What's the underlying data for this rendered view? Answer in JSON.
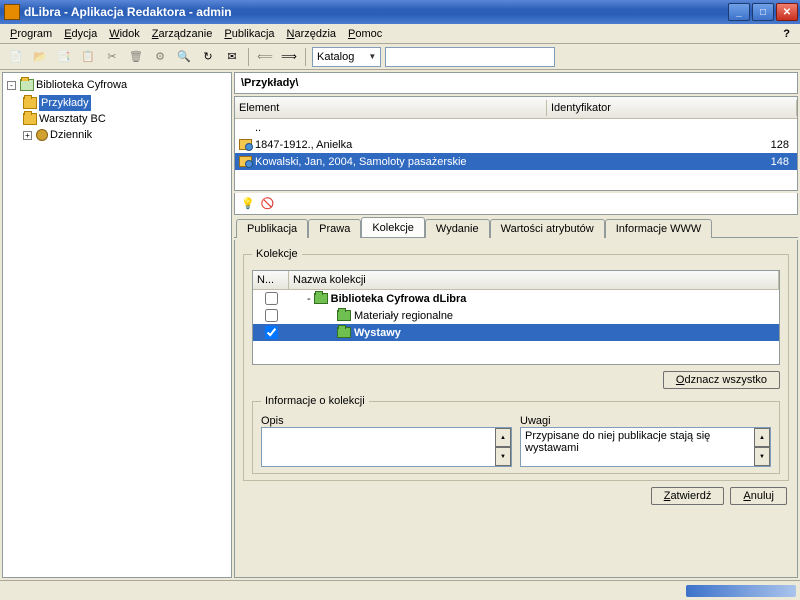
{
  "window": {
    "title": "dLibra - Aplikacja Redaktora - admin"
  },
  "menu": {
    "items": [
      "Program",
      "Edycja",
      "Widok",
      "Zarządzanie",
      "Publikacja",
      "Narzędzia",
      "Pomoc"
    ],
    "help_icon": "?"
  },
  "toolbar": {
    "catalog_label": "Katalog",
    "search_value": ""
  },
  "tree": {
    "root": "Biblioteka Cyfrowa",
    "children": [
      {
        "label": "Przykłady",
        "selected": true
      },
      {
        "label": "Warsztaty BC"
      },
      {
        "label": "Dziennik",
        "expandable": true,
        "icon": "gear"
      }
    ]
  },
  "path": "\\Przykłady\\",
  "list": {
    "col_element": "Element",
    "col_ident": "Identyfikator",
    "parent": "..",
    "rows": [
      {
        "label": "1847-1912., Anielka",
        "id": "128",
        "selected": false
      },
      {
        "label": "Kowalski, Jan, 2004, Samoloty pasażerskie",
        "id": "148",
        "selected": true
      }
    ]
  },
  "tabs": {
    "items": [
      "Publikacja",
      "Prawa",
      "Kolekcje",
      "Wydanie",
      "Wartości atrybutów",
      "Informacje WWW"
    ],
    "active": 2
  },
  "kolekcje": {
    "legend": "Kolekcje",
    "col_n": "N...",
    "col_name": "Nazwa kolekcji",
    "rows": [
      {
        "label": "Biblioteka Cyfrowa dLibra",
        "bold": true,
        "indent": 1,
        "checked": false,
        "toggle": "-"
      },
      {
        "label": "Materiały regionalne",
        "indent": 2,
        "checked": false
      },
      {
        "label": "Wystawy",
        "bold": true,
        "indent": 2,
        "checked": true,
        "selected": true
      }
    ],
    "deselect_btn": "Odznacz wszystko"
  },
  "info": {
    "legend": "Informacje o kolekcji",
    "opis_label": "Opis",
    "opis_value": "",
    "uwagi_label": "Uwagi",
    "uwagi_value": "Przypisane do niej publikacje stają się wystawami"
  },
  "buttons": {
    "apply": "Zatwierdź",
    "cancel": "Anuluj"
  }
}
